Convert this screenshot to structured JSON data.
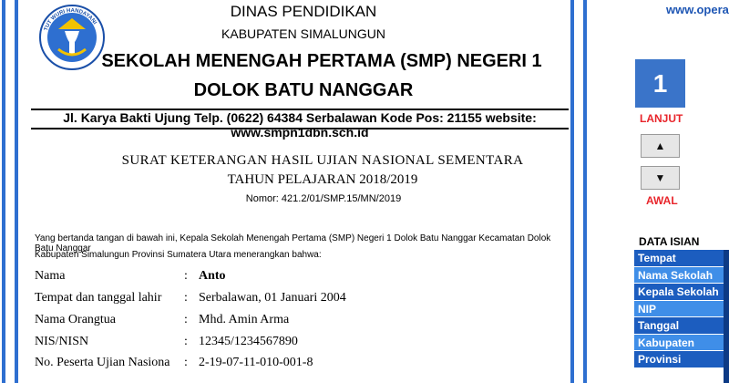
{
  "document": {
    "header": {
      "line1": "DINAS PENDIDIKAN",
      "line2": "KABUPATEN SIMALUNGUN",
      "school_name": "SEKOLAH MENENGAH PERTAMA (SMP) NEGERI 1",
      "location": "DOLOK BATU NANGGAR",
      "address": "Jl. Karya Bakti Ujung Telp. (0622) 64384 Serbalawan Kode Pos: 21155 website: www.smpn1dbn.sch.id",
      "logo_text": "TUT WURI HANDAYANI"
    },
    "title": "SURAT KETERANGAN HASIL UJIAN NASIONAL SEMENTARA",
    "subtitle": "TAHUN PELAJARAN 2018/2019",
    "number": "Nomor: 421.2/01/SMP.15/MN/2019",
    "intro_line1": "Yang bertanda tangan di bawah ini, Kepala Sekolah Menengah Pertama (SMP) Negeri 1 Dolok Batu Nanggar Kecamatan Dolok Batu Nanggar",
    "intro_line2": "Kabupaten Simalungun Provinsi Sumatera Utara menerangkan bahwa:",
    "separator": ":",
    "fields": [
      {
        "label": "Nama",
        "value": "Anto"
      },
      {
        "label": "Tempat dan tanggal lahir",
        "value": "Serbalawan, 01 Januari 2004"
      },
      {
        "label": "Nama Orangtua",
        "value": "Mhd. Amin Arma"
      },
      {
        "label": "NIS/NISN",
        "value": "12345/1234567890"
      },
      {
        "label": "No. Peserta Ujian Nasiona",
        "value": "2-19-07-11-010-001-8"
      }
    ]
  },
  "panel": {
    "url": "www.operat",
    "current_number": "1",
    "next_label": "LANJUT",
    "up_icon": "▲",
    "down_icon": "▼",
    "first_label": "AWAL",
    "data_title": "DATA ISIAN",
    "data_items": [
      "Tempat",
      "Nama Sekolah",
      "Kepala Sekolah",
      "NIP",
      "Tanggal",
      "Kabupaten",
      "Provinsi"
    ],
    "colors": {
      "accent": "#3a74c9",
      "alert": "#e8252b",
      "list_dark": "#1c5dbf",
      "list_light": "#3f8ee8"
    }
  }
}
